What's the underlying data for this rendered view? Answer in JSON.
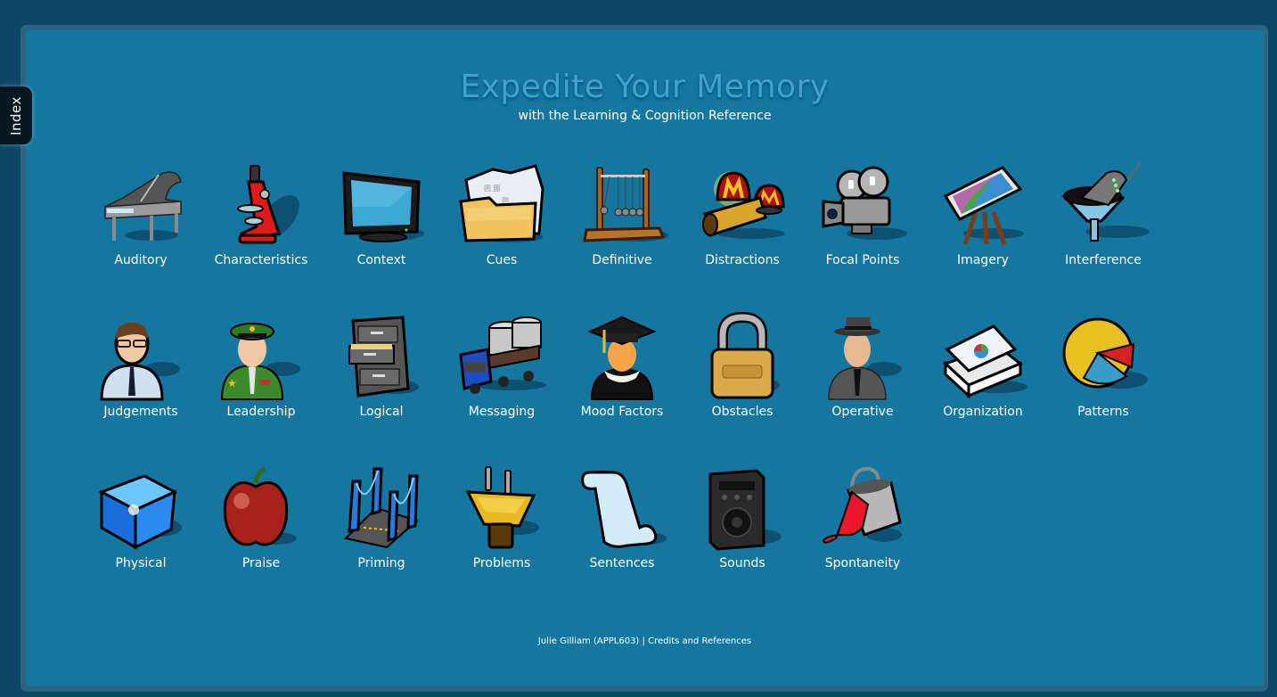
{
  "index_tab": {
    "label": "Index"
  },
  "header": {
    "title": "Expedite Your Memory",
    "subtitle": "with the Learning & Cognition Reference"
  },
  "colors": {
    "page_background": "#0e4668",
    "frame_border": "#2b6582",
    "stage_background": "#15779f",
    "title": "#3fa3cf",
    "text": "#ffffff"
  },
  "topics": [
    {
      "label": "Auditory",
      "icon": "grand-piano-icon"
    },
    {
      "label": "Characteristics",
      "icon": "microscope-icon"
    },
    {
      "label": "Context",
      "icon": "monitor-icon"
    },
    {
      "label": "Cues",
      "icon": "folder-icon"
    },
    {
      "label": "Definitive",
      "icon": "newtons-cradle-icon"
    },
    {
      "label": "Distractions",
      "icon": "alarm-siren-icon"
    },
    {
      "label": "Focal Points",
      "icon": "movie-camera-icon"
    },
    {
      "label": "Imagery",
      "icon": "easel-icon"
    },
    {
      "label": "Interference",
      "icon": "funnel-icon"
    },
    {
      "label": "Judgements",
      "icon": "businessman-icon"
    },
    {
      "label": "Leadership",
      "icon": "officer-icon"
    },
    {
      "label": "Logical",
      "icon": "filing-cabinet-icon"
    },
    {
      "label": "Messaging",
      "icon": "delivery-truck-icon"
    },
    {
      "label": "Mood Factors",
      "icon": "graduate-icon"
    },
    {
      "label": "Obstacles",
      "icon": "padlock-icon"
    },
    {
      "label": "Operative",
      "icon": "detective-icon"
    },
    {
      "label": "Organization",
      "icon": "document-stack-icon"
    },
    {
      "label": "Patterns",
      "icon": "pie-chart-icon"
    },
    {
      "label": "Physical",
      "icon": "cube-icon"
    },
    {
      "label": "Praise",
      "icon": "apple-icon"
    },
    {
      "label": "Priming",
      "icon": "bridge-icon"
    },
    {
      "label": "Problems",
      "icon": "power-plug-icon"
    },
    {
      "label": "Sentences",
      "icon": "scroll-icon"
    },
    {
      "label": "Sounds",
      "icon": "speaker-icon"
    },
    {
      "label": "Spontaneity",
      "icon": "paint-bucket-icon"
    }
  ],
  "footer": {
    "author": "Julie Gilliam (APPL603)",
    "separator": " | ",
    "credits_link": "Credits and References"
  }
}
